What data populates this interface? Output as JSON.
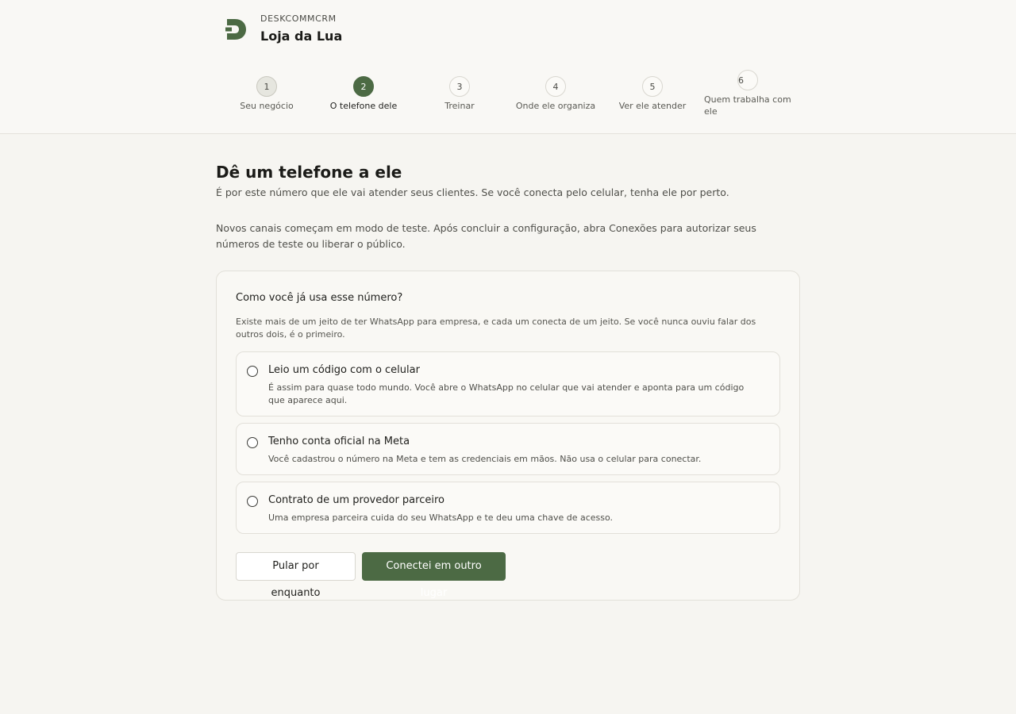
{
  "brand": {
    "company": "DESKCOMMCRM",
    "store": "Loja da Lua",
    "logo_icon": "deskcomm-d-logo-icon",
    "accent_color": "#4c6a44"
  },
  "stepper": {
    "steps": [
      {
        "number": "1",
        "label": "Seu negócio",
        "state": "done"
      },
      {
        "number": "2",
        "label": "O telefone dele",
        "state": "active"
      },
      {
        "number": "3",
        "label": "Treinar",
        "state": "pending"
      },
      {
        "number": "4",
        "label": "Onde ele organiza",
        "state": "pending"
      },
      {
        "number": "5",
        "label": "Ver ele atender",
        "state": "pending"
      },
      {
        "number": "6",
        "label": "Quem trabalha com ele",
        "state": "pending"
      }
    ]
  },
  "main": {
    "title": "Dê um telefone a ele",
    "subtitle": "É por este número que ele vai atender seus clientes. Se você conecta pelo celular, tenha ele por perto.",
    "notice": "Novos canais começam em modo de teste. Após concluir a configuração, abra Conexões para autorizar seus números de teste ou liberar o público."
  },
  "card": {
    "question": "Como você já usa esse número?",
    "helper": "Existe mais de um jeito de ter WhatsApp para empresa, e cada um conecta de um jeito. Se você nunca ouviu falar dos outros dois, é o primeiro.",
    "options": [
      {
        "title": "Leio um código com o celular",
        "description": "É assim para quase todo mundo. Você abre o WhatsApp no celular que vai atender e aponta para um código que aparece aqui."
      },
      {
        "title": "Tenho conta oficial na Meta",
        "description": "Você cadastrou o número na Meta e tem as credenciais em mãos. Não usa o celular para conectar."
      },
      {
        "title": "Contrato de um provedor parceiro",
        "description": "Uma empresa parceira cuida do seu WhatsApp e te deu uma chave de acesso."
      }
    ],
    "skip_label": "Pular por enquanto",
    "connected_label": "Conectei em outro lugar"
  }
}
